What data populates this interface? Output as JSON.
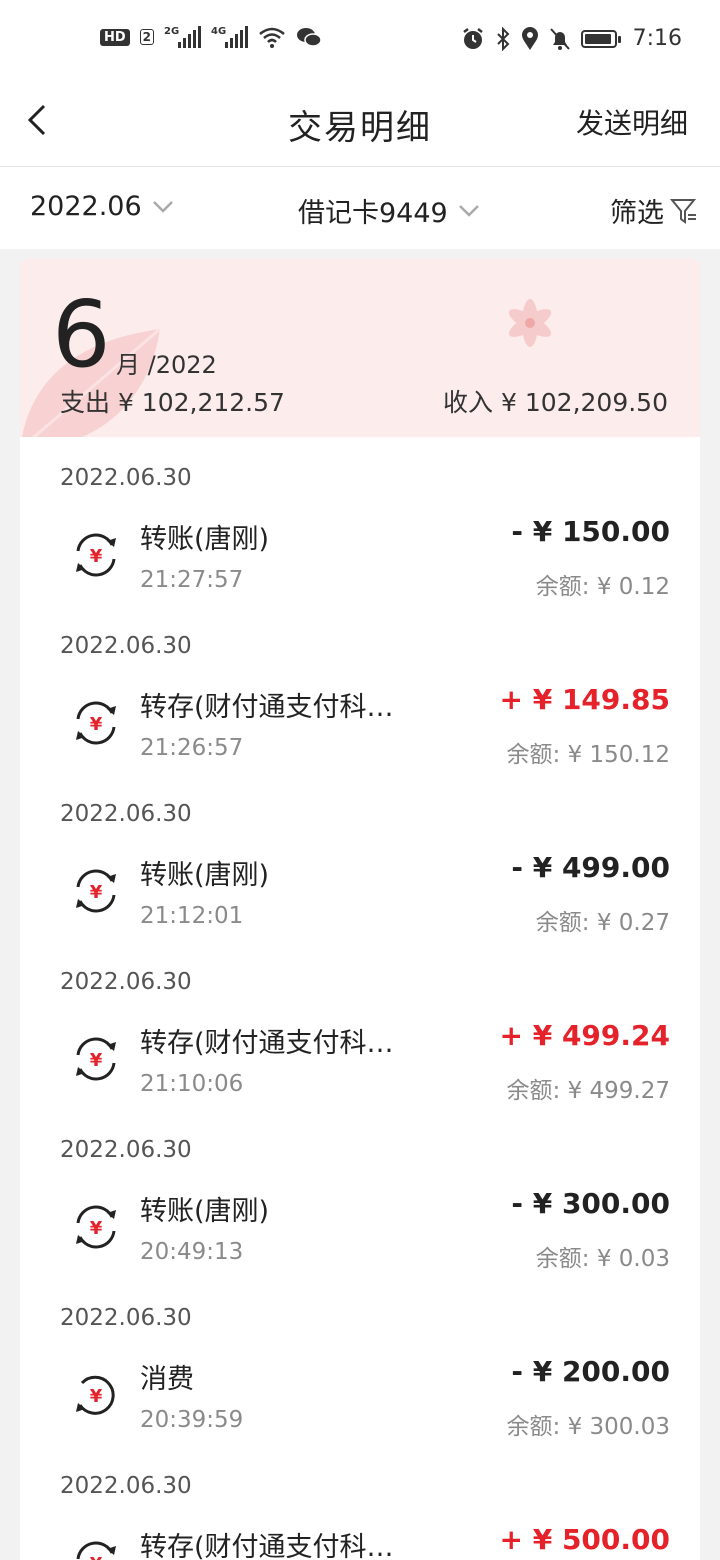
{
  "status_bar": {
    "hd_label": "HD",
    "hd_sim": "2",
    "net1": "2G",
    "net2": "4G",
    "time": "7:16"
  },
  "header": {
    "title": "交易明细",
    "send_label": "发送明细"
  },
  "filters": {
    "month": "2022.06",
    "card": "借记卡9449",
    "filter_label": "筛选"
  },
  "summary": {
    "month": "6",
    "month_suffix": "月 /2022",
    "spend": "支出 ¥ 102,212.57",
    "income": "收入 ¥ 102,209.50"
  },
  "colors": {
    "accent_red": "#e5212a",
    "summary_bg": "#fcecec"
  },
  "transactions": [
    {
      "date": "2022.06.30",
      "title": "转账(唐刚)",
      "time": "21:27:57",
      "amount": "- ¥ 150.00",
      "balance": "余额: ¥ 0.12",
      "direction": "out",
      "icon": "transfer-icon"
    },
    {
      "date": "2022.06.30",
      "title": "转存(财付通支付科…",
      "time": "21:26:57",
      "amount": "+ ¥ 149.85",
      "balance": "余额: ¥ 150.12",
      "direction": "in",
      "icon": "transfer-icon"
    },
    {
      "date": "2022.06.30",
      "title": "转账(唐刚)",
      "time": "21:12:01",
      "amount": "- ¥ 499.00",
      "balance": "余额: ¥ 0.27",
      "direction": "out",
      "icon": "transfer-icon"
    },
    {
      "date": "2022.06.30",
      "title": "转存(财付通支付科…",
      "time": "21:10:06",
      "amount": "+ ¥ 499.24",
      "balance": "余额: ¥ 499.27",
      "direction": "in",
      "icon": "transfer-icon"
    },
    {
      "date": "2022.06.30",
      "title": "转账(唐刚)",
      "time": "20:49:13",
      "amount": "- ¥ 300.00",
      "balance": "余额: ¥ 0.03",
      "direction": "out",
      "icon": "transfer-icon"
    },
    {
      "date": "2022.06.30",
      "title": "消费",
      "time": "20:39:59",
      "amount": "- ¥ 200.00",
      "balance": "余额: ¥ 300.03",
      "direction": "out",
      "icon": "consume-icon"
    },
    {
      "date": "2022.06.30",
      "title": "转存(财付通支付科…",
      "time": "",
      "amount": "+ ¥ 500.00",
      "balance": "",
      "direction": "in",
      "icon": "transfer-icon"
    }
  ]
}
